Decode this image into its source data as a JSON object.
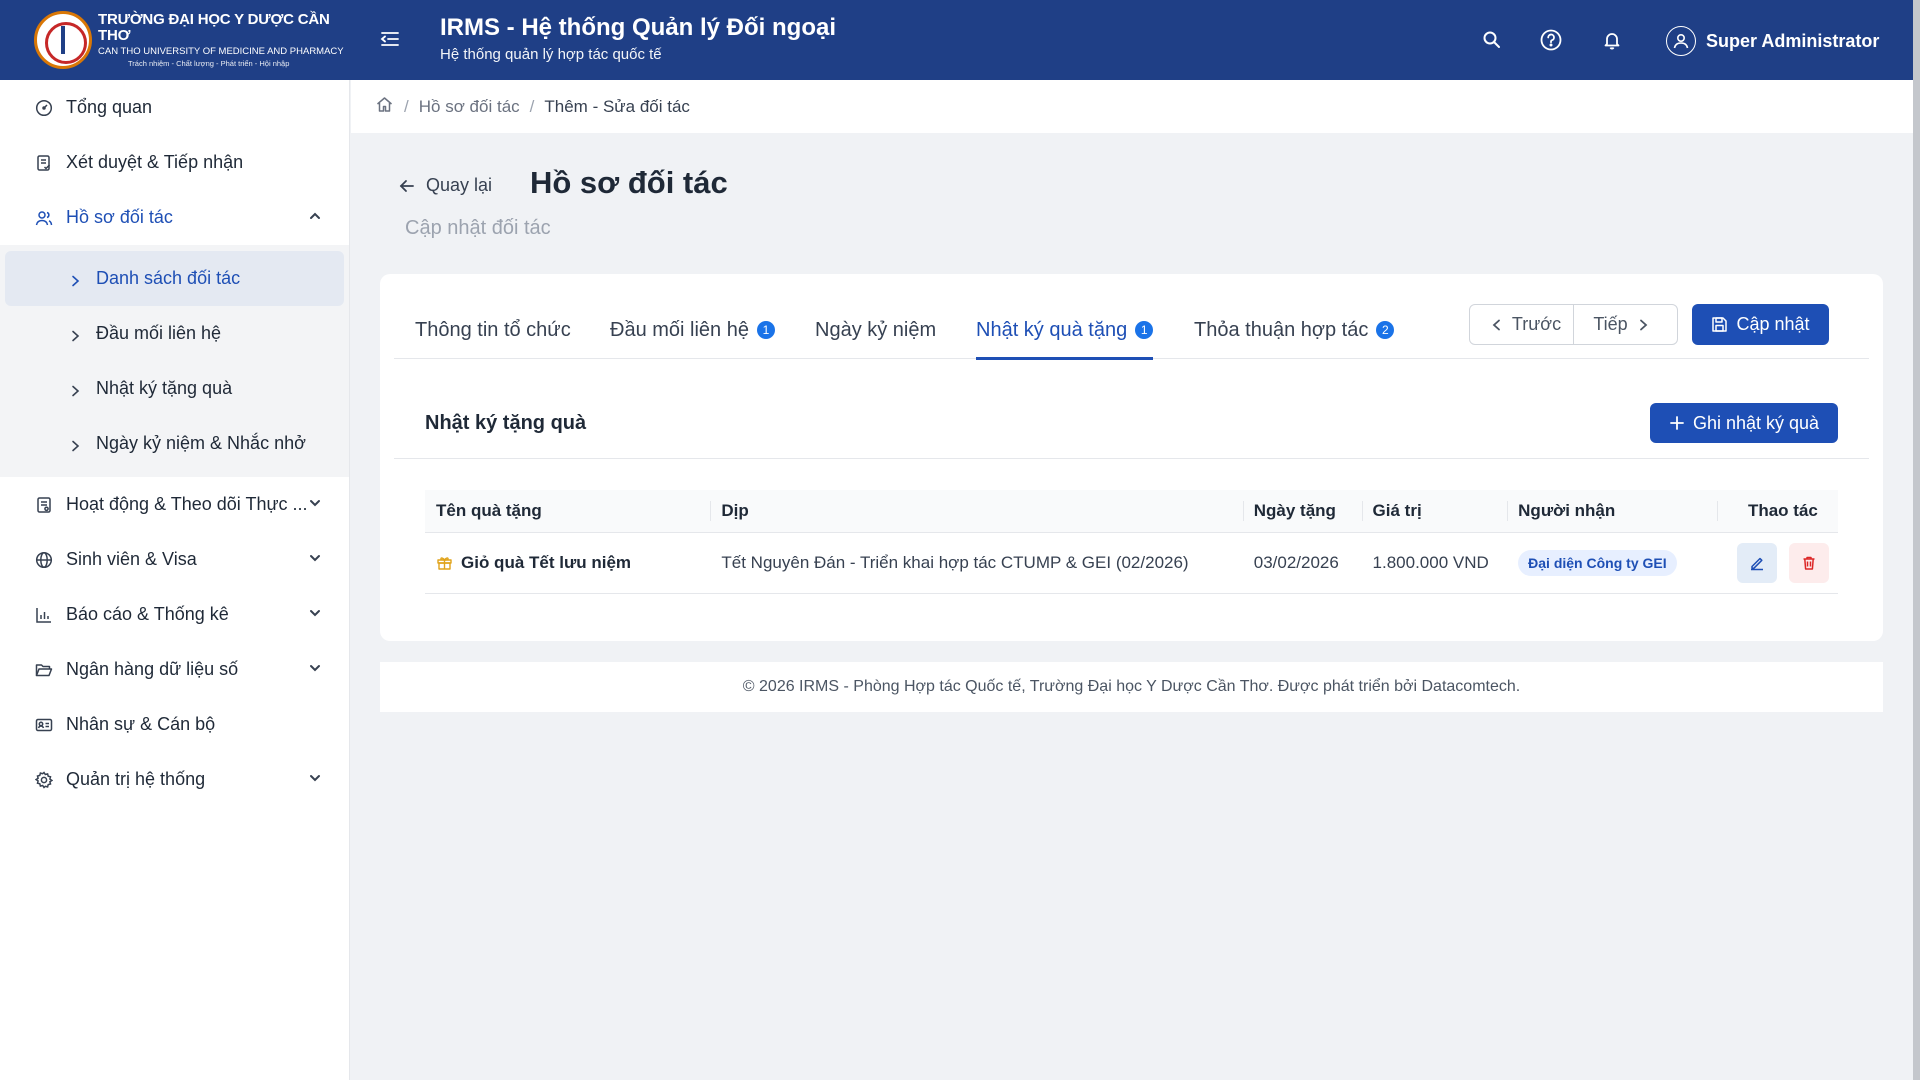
{
  "header": {
    "brand": {
      "line1": "TRƯỜNG ĐẠI HỌC Y DƯỢC CẦN THƠ",
      "line2": "CAN THO UNIVERSITY OF MEDICINE AND PHARMACY",
      "line3": "Trách nhiệm - Chất lượng - Phát triển - Hội nhập"
    },
    "title": "IRMS - Hệ thống Quản lý Đối ngoại",
    "subtitle": "Hệ thống quản lý hợp tác quốc tế",
    "user_name": "Super Administrator",
    "icons": [
      "menu-collapse-icon",
      "search-icon",
      "help-icon",
      "bell-icon",
      "user-icon"
    ],
    "colors": {
      "primary": "#1f3f86",
      "accent": "#1e4fb5"
    }
  },
  "sidebar": {
    "items": [
      {
        "label": "Tổng quan",
        "icon": "dashboard-icon"
      },
      {
        "label": "Xét duyệt & Tiếp nhận",
        "icon": "clipboard-check-icon"
      },
      {
        "label": "Hồ sơ đối tác",
        "icon": "users-icon",
        "expanded": true,
        "children": [
          {
            "label": "Danh sách đối tác",
            "current": true
          },
          {
            "label": "Đầu mối liên hệ"
          },
          {
            "label": "Nhật ký tặng quà"
          },
          {
            "label": "Ngày kỷ niệm & Nhắc nhở"
          }
        ]
      },
      {
        "label": "Hoạt động & Theo dõi Thực ...",
        "icon": "activity-icon"
      },
      {
        "label": "Sinh viên & Visa",
        "icon": "globe-icon"
      },
      {
        "label": "Báo cáo & Thống kê",
        "icon": "bar-chart-icon"
      },
      {
        "label": "Ngân hàng dữ liệu số",
        "icon": "folder-open-icon"
      },
      {
        "label": "Nhân sự & Cán bộ",
        "icon": "id-card-icon"
      },
      {
        "label": "Quản trị hệ thống",
        "icon": "settings-icon"
      }
    ]
  },
  "breadcrumb": {
    "items": [
      "Hồ sơ đối tác",
      "Thêm - Sửa đối tác"
    ]
  },
  "page": {
    "back_label": "Quay lại",
    "title": "Hồ sơ đối tác",
    "subtitle": "Cập nhật đối tác"
  },
  "tabs": [
    {
      "label": "Thông tin tổ chức"
    },
    {
      "label": "Đầu mối liên hệ",
      "badge": "1"
    },
    {
      "label": "Ngày kỷ niệm"
    },
    {
      "label": "Nhật ký quà tặng",
      "badge": "1",
      "active": true
    },
    {
      "label": "Thỏa thuận hợp tác",
      "badge": "2"
    }
  ],
  "pager": {
    "prev_label": "Trước",
    "next_label": "Tiếp"
  },
  "update_button": "Cập nhật",
  "gift_section": {
    "title": "Nhật ký tặng quà",
    "add_button": "Ghi nhật ký quà",
    "columns": [
      "Tên quà tặng",
      "Dịp",
      "Ngày tặng",
      "Giá trị",
      "Người nhận",
      "Thao tác"
    ],
    "rows": [
      {
        "name": "Giỏ quà Tết lưu niệm",
        "occasion": "Tết Nguyên Đán - Triển khai hợp tác CTUMP & GEI (02/2026)",
        "date": "03/02/2026",
        "value": "1.800.000 VND",
        "recipient": "Đại diện Công ty GEI"
      }
    ]
  },
  "footer": "© 2026 IRMS - Phòng Hợp tác Quốc tế, Trường Đại học Y Dược Cần Thơ. Được phát triển bởi Datacomtech."
}
